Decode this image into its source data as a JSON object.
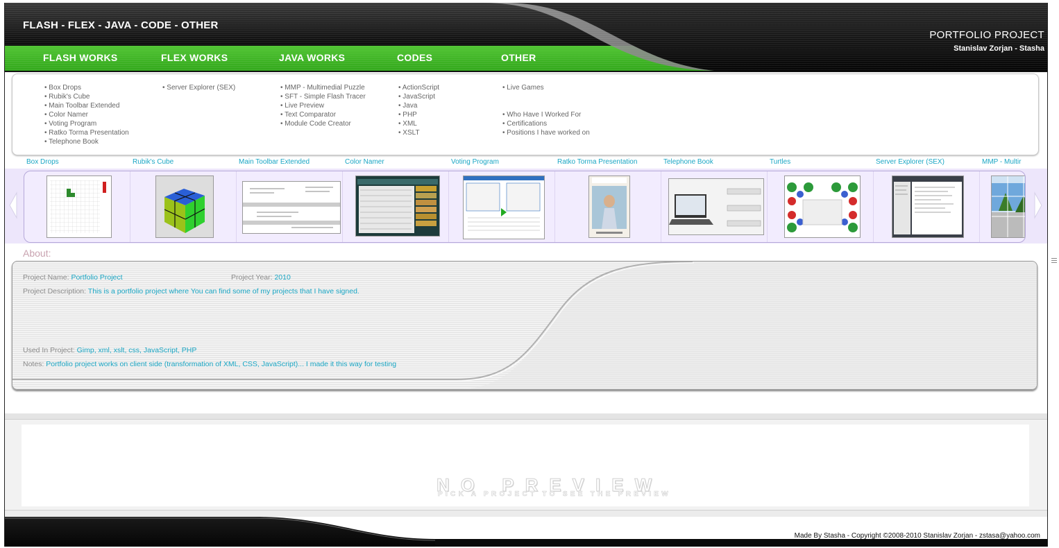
{
  "header": {
    "site_title": "FLASH - FLEX - JAVA - CODE - OTHER",
    "project_title": "PORTFOLIO PROJECT",
    "author": "Stanislav Zorjan - Stasha"
  },
  "nav": [
    {
      "label": "FLASH WORKS"
    },
    {
      "label": "FLEX WORKS"
    },
    {
      "label": "JAVA WORKS"
    },
    {
      "label": "CODES"
    },
    {
      "label": "OTHER"
    }
  ],
  "links": {
    "flash": [
      "Box Drops",
      "Rubik's Cube",
      "Main Toolbar Extended",
      "Color Namer",
      "Voting Program",
      "Ratko Torma Presentation",
      "Telephone Book"
    ],
    "flex": [
      "Server Explorer (SEX)"
    ],
    "java": [
      "MMP - Multimedial Puzzle",
      "SFT - Simple Flash Tracer",
      "Live Preview",
      "Text Comparator",
      "Module Code Creator"
    ],
    "codes": [
      "ActionScript",
      "JavaScript",
      "Java",
      "PHP",
      "XML",
      "XSLT"
    ],
    "other_top": [
      "Live Games"
    ],
    "other_bottom": [
      "Who Have I Worked For",
      "Certifications",
      "Positions I have worked on"
    ]
  },
  "carousel": {
    "labels": [
      "Box Drops",
      "Rubik's Cube",
      "Main Toolbar Extended",
      "Color Namer",
      "Voting Program",
      "Ratko Torma Presentation",
      "Telephone Book",
      "Turtles",
      "Server Explorer (SEX)",
      "MMP - Multir"
    ]
  },
  "about": {
    "title": "About:",
    "project_name_label": "Project Name:",
    "project_name": "Portfolio Project",
    "project_year_label": "Project Year:",
    "project_year": "2010",
    "description_label": "Project Description:",
    "description": "This is a portfolio project where You can find some of my projects that I have signed.",
    "used_label": "Used In Project:",
    "used": "Gimp, xml, xslt, css, JavaScript, PHP",
    "notes_label": "Notes:",
    "notes": "Portfolio project works on client side (transformation of XML, CSS, JavaScript)... I made it this way for testing"
  },
  "preview": {
    "title": "NO PREVIEW",
    "subtitle": "PICK A PROJECT TO SEE THE PREVIEW"
  },
  "footer": {
    "text": "Made By Stasha - Copyright ©2008-2010 Stanislav Zorjan - zstasa@yahoo.com"
  },
  "colors": {
    "accent_green": "#3db824",
    "link_cyan": "#1aa6c4",
    "carousel_band": "#ede6fb"
  }
}
